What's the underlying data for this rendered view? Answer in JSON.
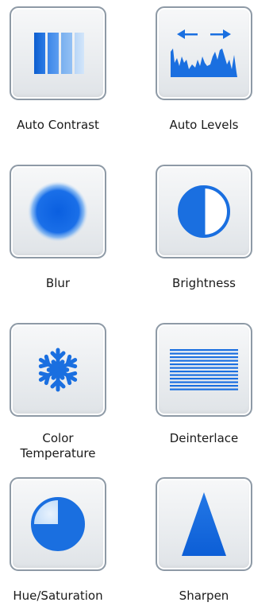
{
  "tools": [
    {
      "label": "Auto Contrast",
      "icon": "contrast-bars-icon"
    },
    {
      "label": "Auto Levels",
      "icon": "histogram-levels-icon"
    },
    {
      "label": "Blur",
      "icon": "blur-circle-icon"
    },
    {
      "label": "Brightness",
      "icon": "half-circle-icon"
    },
    {
      "label": "Color Temperature",
      "icon": "snowflake-icon"
    },
    {
      "label": "Deinterlace",
      "icon": "horizontal-lines-icon"
    },
    {
      "label": "Hue/Saturation",
      "icon": "pie-circle-icon"
    },
    {
      "label": "Sharpen",
      "icon": "triangle-icon"
    }
  ],
  "colors": {
    "accent": "#1a6fe0",
    "accent_light": "#6fb0f5",
    "button_border": "#8e9aa6"
  }
}
